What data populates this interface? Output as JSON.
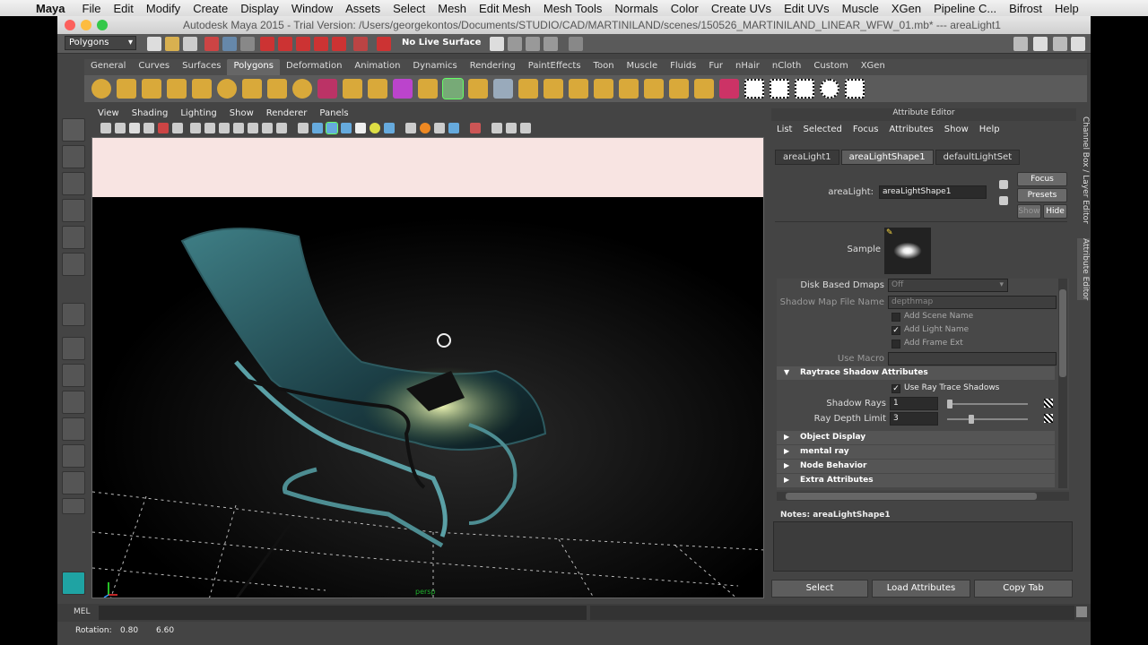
{
  "menubar": {
    "app": "Maya",
    "items": [
      "File",
      "Edit",
      "Modify",
      "Create",
      "Display",
      "Window",
      "Assets",
      "Select",
      "Mesh",
      "Edit Mesh",
      "Mesh Tools",
      "Normals",
      "Color",
      "Create UVs",
      "Edit UVs",
      "Muscle",
      "XGen",
      "Pipeline C...",
      "Bifrost",
      "Help"
    ]
  },
  "window": {
    "title": "Autodesk Maya 2015 - Trial Version: /Users/georgekontos/Documents/STUDIO/CAD/MARTINILAND/scenes/150526_MARTINILAND_LINEAR_WFW_01.mb*   ---   areaLight1"
  },
  "statusline": {
    "menuset": "Polygons",
    "live_surface": "No Live Surface"
  },
  "shelf": {
    "tabs": [
      "General",
      "Curves",
      "Surfaces",
      "Polygons",
      "Deformation",
      "Animation",
      "Dynamics",
      "Rendering",
      "PaintEffects",
      "Toon",
      "Muscle",
      "Fluids",
      "Fur",
      "nHair",
      "nCloth",
      "Custom",
      "XGen"
    ],
    "active_tab": "Polygons"
  },
  "viewport": {
    "menu": [
      "View",
      "Shading",
      "Lighting",
      "Show",
      "Renderer",
      "Panels"
    ],
    "camera_label": "persp"
  },
  "attribute_editor": {
    "title": "Attribute Editor",
    "menu": [
      "List",
      "Selected",
      "Focus",
      "Attributes",
      "Show",
      "Help"
    ],
    "tabs": [
      "areaLight1",
      "areaLightShape1",
      "defaultLightSet"
    ],
    "active_tab": "areaLightShape1",
    "node_type_label": "areaLight:",
    "node_name": "areaLightShape1",
    "focus_button": "Focus",
    "presets_button": "Presets",
    "show_button": "Show",
    "hide_button": "Hide",
    "sample_label": "Sample",
    "disk_based_dmaps_label": "Disk Based Dmaps",
    "disk_based_dmaps_value": "Off",
    "shadow_map_file_label": "Shadow Map File Name",
    "shadow_map_file_value": "depthmap",
    "add_scene_name": "Add Scene Name",
    "add_light_name": "Add Light Name",
    "add_frame_ext": "Add Frame Ext",
    "use_macro_label": "Use Macro",
    "raytrace_section": "Raytrace Shadow Attributes",
    "use_ray_trace_shadows": "Use Ray Trace Shadows",
    "shadow_rays_label": "Shadow Rays",
    "shadow_rays_value": "1",
    "ray_depth_limit_label": "Ray Depth Limit",
    "ray_depth_limit_value": "3",
    "collapsed_sections": [
      "Object Display",
      "mental ray",
      "Node Behavior",
      "Extra Attributes"
    ],
    "notes_label": "Notes:  areaLightShape1",
    "bottom_buttons": [
      "Select",
      "Load Attributes",
      "Copy Tab"
    ]
  },
  "side_tabs": [
    "Channel Box / Layer Editor",
    "Attribute Editor"
  ],
  "mel_label": "MEL",
  "helpline": {
    "label": "Rotation:",
    "value1": "0.80",
    "value2": "6.60"
  }
}
